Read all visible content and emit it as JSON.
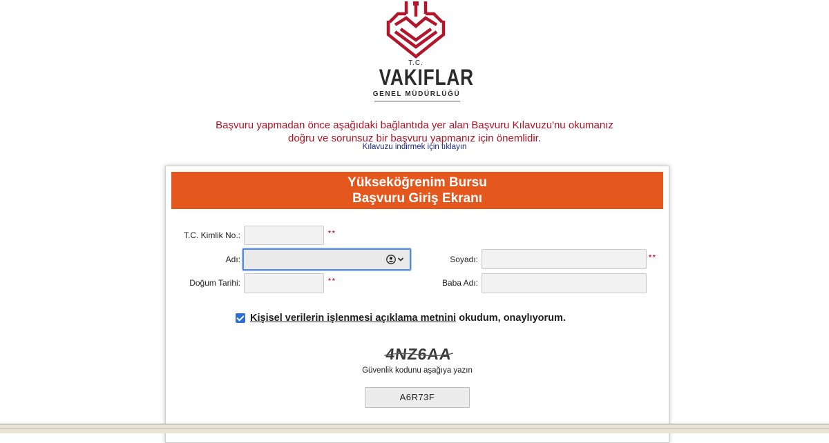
{
  "brand": {
    "tc": "T.C.",
    "name": "VAKIFLAR",
    "subtitle": "GENEL MÜDÜRLÜĞÜ",
    "logo_color": "#b3162b"
  },
  "notice": {
    "line1": "Başvuru yapmadan önce aşağıdaki bağlantıda yer alan Başvuru Kılavuzu'nu okumanız",
    "line2": "doğru ve sorunsuz bir başvuru yapmanız için önemlidir.",
    "link": "Kılavuzu indirmek için tıklayın",
    "color": "#b01324"
  },
  "panel": {
    "title_line1": "Yükseköğrenim Bursu",
    "title_line2": "Başvuru Giriş Ekranı",
    "header_color": "#e4581e"
  },
  "form": {
    "tc_label": "T.C. Kimlik No.:",
    "tc_value": "",
    "name_label": "Adı:",
    "name_value": "",
    "surname_label": "Soyadı:",
    "surname_value": "",
    "birth_label": "Doğum Tarihi:",
    "birth_value": "",
    "father_label": "Baba Adı:",
    "father_value": "",
    "required_mark": "**",
    "autofill_icon": "contact-card-icon"
  },
  "consent": {
    "checked": true,
    "link_text": "Kişisel verilerin işlenmesi açıklama metnini",
    "rest_text": " okudum, onaylıyorum."
  },
  "captcha": {
    "image_text": "4NZ6AA",
    "hint": "Güvenlik kodunu aşağıya yazın",
    "entered_value": "A6R73F"
  }
}
